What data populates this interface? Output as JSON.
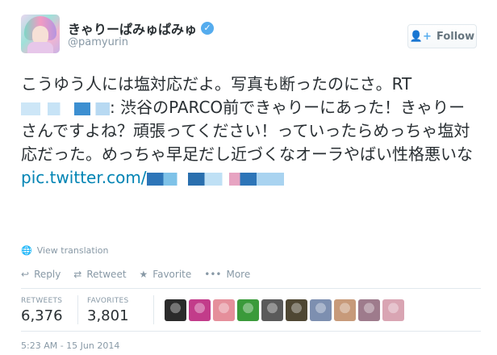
{
  "header": {
    "fullname": "きゃりーぱみゅぱみゅ",
    "username": "@pamyurin",
    "verified_icon": "verified-badge",
    "follow_label": "Follow",
    "follow_icon": "follow-person-icon"
  },
  "tweet": {
    "text_part1": "こうゆう人には塩対応だよ。写真も断ったのにさ。RT ",
    "text_part2": ": 渋谷のPARCO前できゃりーにあった！きゃりーさんですよね？頑張ってください！っていったらめっちゃ塩対応だった。めっちゃ早足だし近づくなオーラやばい性格悪いな ",
    "pic_link": "pic.twitter.com/",
    "view_translation": "View translation"
  },
  "actions": {
    "reply": "Reply",
    "retweet": "Retweet",
    "favorite": "Favorite",
    "more": "More"
  },
  "stats": {
    "retweets_label": "RETWEETS",
    "retweets_value": "6,376",
    "favorites_label": "FAVORITES",
    "favorites_value": "3,801"
  },
  "favoriters": {
    "colors": [
      "#2b2b2b",
      "#c23c8a",
      "#e58f9b",
      "#3a9a3a",
      "#5a5a5a",
      "#4f4733",
      "#7d8fb0",
      "#c79a7a",
      "#9e7b8c",
      "#d9a5b3"
    ]
  },
  "timestamp": "5:23 AM - 15 Jun 2014",
  "colors": {
    "link": "#0084b4",
    "muted": "#8899a6",
    "accent": "#55acee"
  }
}
